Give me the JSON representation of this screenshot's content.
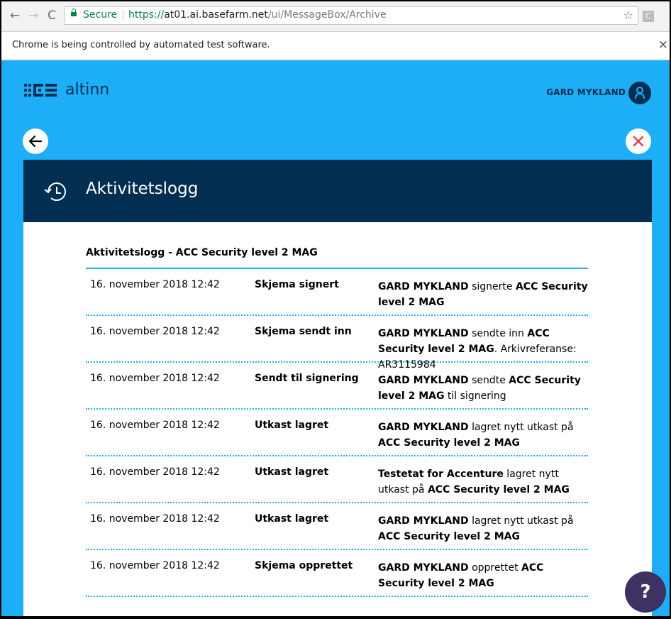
{
  "browser": {
    "secure_label": "Secure",
    "url_scheme": "https://",
    "url_host": "at01.ai.basefarm.net",
    "url_path": "/ui/MessageBox/Archive",
    "infobar_text": "Chrome is being controlled by automated test software.",
    "ext_label": "C"
  },
  "header": {
    "logo_text": "altinn",
    "user_name": "GARD MYKLAND"
  },
  "modal": {
    "title": "Aktivitetslogg",
    "heading": "Aktivitetslogg - ACC Security level 2 MAG"
  },
  "log": [
    {
      "date": "16. november 2018 12:42",
      "action": "Skjema signert",
      "desc": [
        {
          "t": "GARD MYKLAND",
          "b": true
        },
        {
          "t": " signerte "
        },
        {
          "t": "ACC Security level 2 MAG",
          "b": true
        }
      ]
    },
    {
      "date": "16. november 2018 12:42",
      "action": "Skjema sendt inn",
      "desc": [
        {
          "t": "GARD MYKLAND",
          "b": true
        },
        {
          "t": " sendte inn "
        },
        {
          "t": "ACC Security level 2 MAG",
          "b": true
        },
        {
          "t": ". Arkivreferanse: AR3115984"
        }
      ]
    },
    {
      "date": "16. november 2018 12:42",
      "action": "Sendt til signering",
      "desc": [
        {
          "t": "GARD MYKLAND",
          "b": true
        },
        {
          "t": " sendte "
        },
        {
          "t": "ACC Security level 2 MAG",
          "b": true
        },
        {
          "t": " til signering"
        }
      ]
    },
    {
      "date": "16. november 2018 12:42",
      "action": "Utkast lagret",
      "desc": [
        {
          "t": "GARD MYKLAND",
          "b": true
        },
        {
          "t": " lagret nytt utkast på "
        },
        {
          "t": "ACC Security level 2 MAG",
          "b": true
        }
      ]
    },
    {
      "date": "16. november 2018 12:42",
      "action": "Utkast lagret",
      "desc": [
        {
          "t": "Testetat for Accenture",
          "b": true
        },
        {
          "t": " lagret nytt utkast på "
        },
        {
          "t": "ACC Security level 2 MAG",
          "b": true
        }
      ]
    },
    {
      "date": "16. november 2018 12:42",
      "action": "Utkast lagret",
      "desc": [
        {
          "t": "GARD MYKLAND",
          "b": true
        },
        {
          "t": " lagret nytt utkast på "
        },
        {
          "t": "ACC Security level 2 MAG",
          "b": true
        }
      ]
    },
    {
      "date": "16. november 2018 12:42",
      "action": "Skjema opprettet",
      "desc": [
        {
          "t": "GARD MYKLAND",
          "b": true
        },
        {
          "t": " opprettet "
        },
        {
          "t": "ACC Security level 2 MAG",
          "b": true
        }
      ]
    }
  ],
  "help": {
    "label": "?"
  },
  "colors": {
    "accent": "#1eaef7",
    "navy": "#022f51",
    "close_red": "#e23b53",
    "help_purple": "#3f3161"
  }
}
